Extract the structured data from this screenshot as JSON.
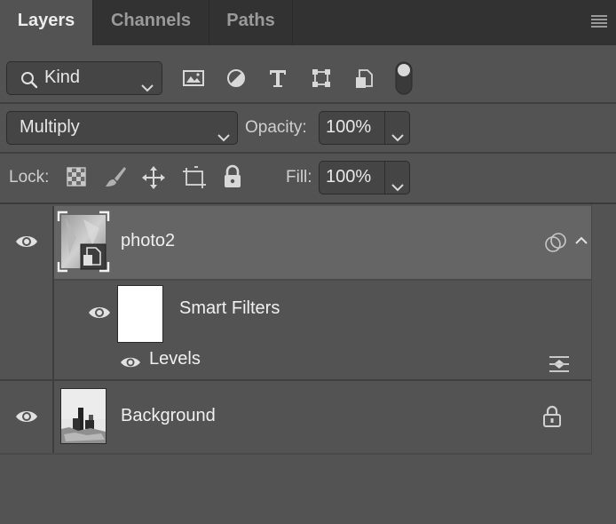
{
  "tabs": [
    {
      "label": "Layers"
    },
    {
      "label": "Channels"
    },
    {
      "label": "Paths"
    }
  ],
  "filter": {
    "kind_label": "Kind",
    "icons": [
      "image-filter-icon",
      "adjustment-filter-icon",
      "type-filter-icon",
      "shape-filter-icon",
      "smart-object-filter-icon",
      "filter-toggle-icon"
    ]
  },
  "blend": {
    "mode": "Multiply",
    "opacity_label": "Opacity:",
    "opacity_value": "100%"
  },
  "lock": {
    "label": "Lock:",
    "fill_label": "Fill:",
    "fill_value": "100%",
    "icons": [
      "lock-transparent-pixels-icon",
      "lock-image-pixels-icon",
      "lock-position-icon",
      "lock-artboard-icon",
      "lock-all-icon"
    ]
  },
  "layers": [
    {
      "name": "photo2",
      "selected": true
    },
    {
      "name": "Smart Filters"
    },
    {
      "name": "Levels"
    },
    {
      "name": "Background",
      "locked": true
    }
  ],
  "colors": {
    "panel": "#535353",
    "tabbar": "#323232",
    "selected_row": "#656565",
    "field": "#454545"
  }
}
